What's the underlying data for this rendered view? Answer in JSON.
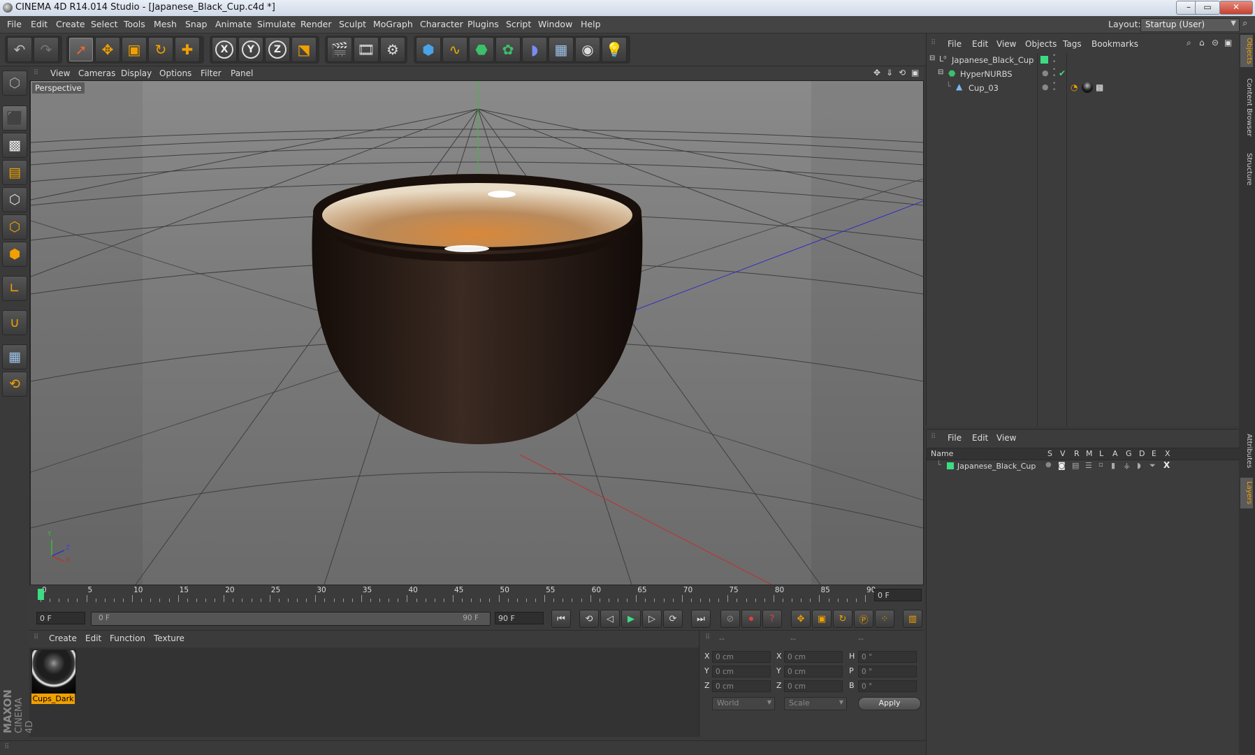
{
  "window": {
    "title": "CINEMA 4D R14.014 Studio - [Japanese_Black_Cup.c4d *]"
  },
  "menubar": {
    "items": [
      "File",
      "Edit",
      "Create",
      "Select",
      "Tools",
      "Mesh",
      "Snap",
      "Animate",
      "Simulate",
      "Render",
      "Sculpt",
      "MoGraph",
      "Character",
      "Plugins",
      "Script",
      "Window",
      "Help"
    ],
    "layout_label": "Layout:",
    "layout_value": "Startup (User)"
  },
  "viewport": {
    "menu": [
      "View",
      "Cameras",
      "Display",
      "Options",
      "Filter",
      "Panel"
    ],
    "label": "Perspective",
    "axis_labels": {
      "y": "Y",
      "z": "Z",
      "x": "X"
    }
  },
  "timeline": {
    "ticks": [
      "0",
      "5",
      "10",
      "15",
      "20",
      "25",
      "30",
      "35",
      "40",
      "45",
      "50",
      "55",
      "60",
      "65",
      "70",
      "75",
      "80",
      "85",
      "90"
    ],
    "current_frame": "0 F"
  },
  "playback": {
    "start_field": "0 F",
    "range_start": "0 F",
    "range_end": "90 F",
    "end_field": "90 F"
  },
  "material_manager": {
    "menu": [
      "Create",
      "Edit",
      "Function",
      "Texture"
    ],
    "materials": [
      {
        "name": "Cups_Dark"
      }
    ]
  },
  "coordinates": {
    "headers": [
      "--",
      "--",
      "--"
    ],
    "rows": [
      {
        "a_label": "X",
        "a_value": "0 cm",
        "b_label": "X",
        "b_value": "0 cm",
        "c_label": "H",
        "c_value": "0 °"
      },
      {
        "a_label": "Y",
        "a_value": "0 cm",
        "b_label": "Y",
        "b_value": "0 cm",
        "c_label": "P",
        "c_value": "0 °"
      },
      {
        "a_label": "Z",
        "a_value": "0 cm",
        "b_label": "Z",
        "b_value": "0 cm",
        "c_label": "B",
        "c_value": "0 °"
      }
    ],
    "mode_select": "World",
    "scale_select": "Scale",
    "apply_label": "Apply"
  },
  "object_manager": {
    "menu": [
      "File",
      "Edit",
      "View",
      "Objects",
      "Tags",
      "Bookmarks"
    ],
    "objects": [
      {
        "name": "Japanese_Black_Cup"
      },
      {
        "name": "HyperNURBS"
      },
      {
        "name": "Cup_03"
      }
    ]
  },
  "layer_manager": {
    "menu": [
      "File",
      "Edit",
      "View"
    ],
    "columns": [
      "Name",
      "S",
      "V",
      "R",
      "M",
      "L",
      "A",
      "G",
      "D",
      "E",
      "X"
    ],
    "layers": [
      {
        "name": "Japanese_Black_Cup",
        "color": "#3ddc84"
      }
    ]
  },
  "side_tabs": [
    "Objects",
    "Content Browser",
    "Structure",
    "Attributes",
    "Layers"
  ],
  "brand": {
    "line1": "MAXON",
    "line2": "CINEMA 4D"
  },
  "colors": {
    "accent": "#f0a000",
    "layer_green": "#3ddc84"
  }
}
